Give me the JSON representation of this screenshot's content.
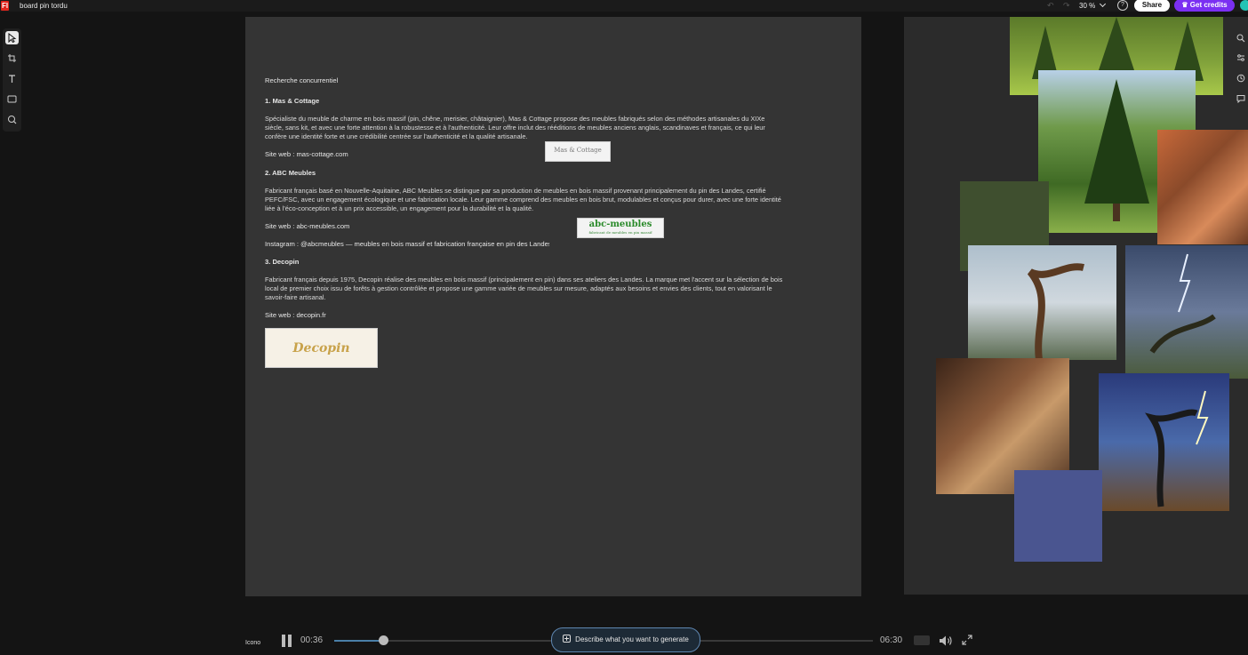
{
  "app": {
    "logo": "Fl",
    "doc_title": "board pin tordu",
    "undo_redo": "↶ ↷",
    "zoom": "30 %",
    "help": "?",
    "share_label": "Share",
    "credits_label": "♛ Get credits"
  },
  "doc": {
    "title": "Recherche concurrentiel",
    "sections": [
      {
        "heading": "1. Mas & Cottage",
        "body": "Spécialiste du meuble de charme en bois massif (pin, chêne, merisier, châtaignier), Mas & Cottage propose des meubles fabriqués selon des méthodes artisanales du XIXe siècle, sans kit, et avec une forte attention à la robustesse et à l'authenticité. Leur offre inclut des rééditions de meubles anciens anglais, scandinaves et français, ce qui leur confère une identité forte et une crédibilité centrée sur l'authenticité et la qualité artisanale.",
        "site": "Site web : mas-cottage.com",
        "logo_text": "Mas & Cottage"
      },
      {
        "heading": "2. ABC Meubles",
        "body": "Fabricant français basé en Nouvelle-Aquitaine, ABC Meubles se distingue par sa production de meubles en bois massif provenant principalement du pin des Landes, certifié PEFC/FSC, avec un engagement écologique et une fabrication locale. Leur gamme comprend des meubles en bois brut, modulables et conçus pour durer, avec une forte identité liée à l'éco-conception et à un prix accessible, un engagement pour la durabilité et la qualité.",
        "site": "Site web : abc-meubles.com",
        "instagram": "Instagram : @abcmeubles — meubles en bois massif et fabrication française en pin des Landes",
        "logo_text": "abc-meubles",
        "logo_sub": "fabricant de meubles en pin massif"
      },
      {
        "heading": "3. Decopin",
        "body": "Fabricant français depuis 1975, Decopin réalise des meubles en bois massif (principalement en pin) dans ses ateliers des Landes. La marque met l'accent sur la sélection de bois local de premier choix issu de forêts à gestion contrôlée et propose une gamme variée de meubles sur mesure, adaptés aux besoins et envies des clients, tout en valorisant le savoir-faire artisanal.",
        "site": "Site web : decopin.fr",
        "logo_text": "Decopin"
      }
    ]
  },
  "canvas": {
    "swatches": [
      "#3f4f2f",
      "#4a5590",
      "#2d2d2d"
    ]
  },
  "player": {
    "left_label": "Icono",
    "current_time": "00:36",
    "total_time": "06:30",
    "progress": 0.09,
    "generate_placeholder": "Describe what you want to generate"
  }
}
